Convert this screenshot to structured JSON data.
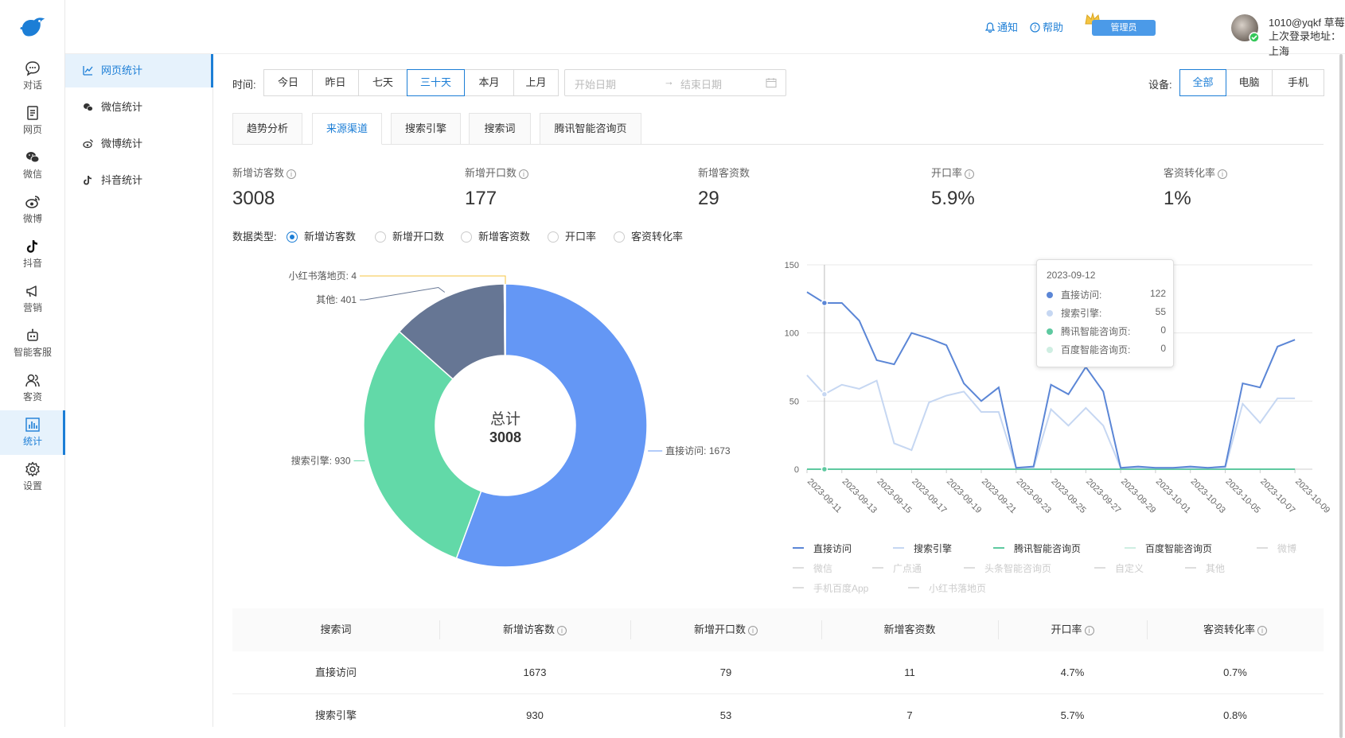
{
  "nav": {
    "items": [
      {
        "label": "对话",
        "icon": "chat-icon"
      },
      {
        "label": "网页",
        "icon": "webpage-icon"
      },
      {
        "label": "微信",
        "icon": "wechat-icon"
      },
      {
        "label": "微博",
        "icon": "weibo-icon"
      },
      {
        "label": "抖音",
        "icon": "douyin-icon"
      },
      {
        "label": "营销",
        "icon": "megaphone-icon"
      },
      {
        "label": "智能客服",
        "icon": "robot-icon"
      },
      {
        "label": "客资",
        "icon": "users-icon"
      },
      {
        "label": "统计",
        "icon": "chart-icon"
      },
      {
        "label": "设置",
        "icon": "gear-icon"
      }
    ]
  },
  "subnav": {
    "items": [
      {
        "label": "网页统计"
      },
      {
        "label": "微信统计"
      },
      {
        "label": "微博统计"
      },
      {
        "label": "抖音统计"
      }
    ]
  },
  "header": {
    "notify": "通知",
    "help": "帮助",
    "admin": "管理员",
    "user": "1010@yqkf 草莓",
    "login_location": "上次登录地址：上海"
  },
  "filters": {
    "time_label": "时间:",
    "time_options": [
      "今日",
      "昨日",
      "七天",
      "三十天",
      "本月",
      "上月"
    ],
    "time_selected": "三十天",
    "start_placeholder": "开始日期",
    "end_placeholder": "结束日期",
    "device_label": "设备:",
    "device_options": [
      "全部",
      "电脑",
      "手机"
    ],
    "device_selected": "全部"
  },
  "tabs": [
    "趋势分析",
    "来源渠道",
    "搜索引擎",
    "搜索词",
    "腾讯智能咨询页"
  ],
  "tab_selected": "来源渠道",
  "stats": [
    {
      "label": "新增访客数",
      "value": "3008",
      "info": true
    },
    {
      "label": "新增开口数",
      "value": "177",
      "info": true
    },
    {
      "label": "新增客资数",
      "value": "29",
      "info": false
    },
    {
      "label": "开口率",
      "value": "5.9%",
      "info": true
    },
    {
      "label": "客资转化率",
      "value": "1%",
      "info": true
    }
  ],
  "data_type": {
    "label": "数据类型:",
    "options": [
      "新增访客数",
      "新增开口数",
      "新增客资数",
      "开口率",
      "客资转化率"
    ],
    "selected": "新增访客数"
  },
  "chart_data": [
    {
      "type": "pie",
      "center_title": "总计",
      "center_value": "3008",
      "slices": [
        {
          "name": "直接访问",
          "value": 1673,
          "color": "#6497f5"
        },
        {
          "name": "搜索引擎",
          "value": 930,
          "color": "#62d9a8"
        },
        {
          "name": "其他",
          "value": 401,
          "color": "#667694"
        },
        {
          "name": "小红书落地页",
          "value": 4,
          "color": "#f5c542"
        }
      ]
    },
    {
      "type": "line",
      "ylim": [
        0,
        150
      ],
      "yticks": [
        0,
        50,
        100,
        150
      ],
      "x": [
        "2023-09-11",
        "2023-09-12",
        "2023-09-13",
        "2023-09-14",
        "2023-09-15",
        "2023-09-16",
        "2023-09-17",
        "2023-09-18",
        "2023-09-19",
        "2023-09-20",
        "2023-09-21",
        "2023-09-22",
        "2023-09-23",
        "2023-09-24",
        "2023-09-25",
        "2023-09-26",
        "2023-09-27",
        "2023-09-28",
        "2023-09-29",
        "2023-09-30",
        "2023-10-01",
        "2023-10-02",
        "2023-10-03",
        "2023-10-04",
        "2023-10-05",
        "2023-10-06",
        "2023-10-07",
        "2023-10-08",
        "2023-10-09",
        "2023-10-10"
      ],
      "xticks": [
        "2023-09-11",
        "2023-09-13",
        "2023-09-15",
        "2023-09-17",
        "2023-09-19",
        "2023-09-21",
        "2023-09-23",
        "2023-09-25",
        "2023-09-27",
        "2023-09-29",
        "2023-10-01",
        "2023-10-03",
        "2023-10-05",
        "2023-10-07",
        "2023-10-09"
      ],
      "series": [
        {
          "name": "直接访问",
          "color": "#5b86d6",
          "values": [
            130,
            122,
            122,
            109,
            80,
            77,
            100,
            96,
            91,
            63,
            50,
            60,
            1,
            2,
            62,
            55,
            75,
            57,
            1,
            2,
            1,
            1,
            2,
            1,
            2,
            63,
            60,
            90,
            95,
            null
          ]
        },
        {
          "name": "搜索引擎",
          "color": "#c6d7f2",
          "values": [
            69,
            55,
            62,
            59,
            65,
            19,
            14,
            49,
            54,
            57,
            42,
            42,
            1,
            1,
            44,
            32,
            45,
            32,
            1,
            1,
            1,
            1,
            1,
            1,
            1,
            48,
            34,
            52,
            52,
            null
          ]
        },
        {
          "name": "腾讯智能咨询页",
          "color": "#5ec9a0",
          "values": [
            0,
            0,
            0,
            0,
            0,
            0,
            0,
            0,
            0,
            0,
            0,
            0,
            0,
            0,
            0,
            0,
            0,
            0,
            0,
            0,
            0,
            0,
            0,
            0,
            0,
            0,
            0,
            0,
            0,
            null
          ]
        },
        {
          "name": "百度智能咨询页",
          "color": "#cfeee2",
          "values": [
            0,
            0,
            0,
            0,
            0,
            0,
            0,
            0,
            0,
            0,
            0,
            0,
            0,
            0,
            0,
            0,
            0,
            0,
            0,
            0,
            0,
            0,
            0,
            0,
            0,
            0,
            0,
            0,
            0,
            null
          ]
        }
      ],
      "hidden_series": [
        "微博",
        "微信",
        "广点通",
        "头条智能咨询页",
        "自定义",
        "其他",
        "手机百度App",
        "小红书落地页"
      ],
      "highlight_index": 1,
      "tooltip": {
        "date": "2023-09-12",
        "rows": [
          {
            "name": "直接访问:",
            "value": "122",
            "color": "#5b86d6"
          },
          {
            "name": "搜索引擎:",
            "value": "55",
            "color": "#c6d7f2"
          },
          {
            "name": "腾讯智能咨询页:",
            "value": "0",
            "color": "#5ec9a0"
          },
          {
            "name": "百度智能咨询页:",
            "value": "0",
            "color": "#cfeee2"
          }
        ]
      }
    }
  ],
  "table": {
    "headers": [
      {
        "label": "搜索词",
        "info": false
      },
      {
        "label": "新增访客数",
        "info": true
      },
      {
        "label": "新增开口数",
        "info": true
      },
      {
        "label": "新增客资数",
        "info": false
      },
      {
        "label": "开口率",
        "info": true
      },
      {
        "label": "客资转化率",
        "info": true
      }
    ],
    "rows": [
      [
        "直接访问",
        "1673",
        "79",
        "11",
        "4.7%",
        "0.7%"
      ],
      [
        "搜索引擎",
        "930",
        "53",
        "7",
        "5.7%",
        "0.8%"
      ]
    ]
  }
}
